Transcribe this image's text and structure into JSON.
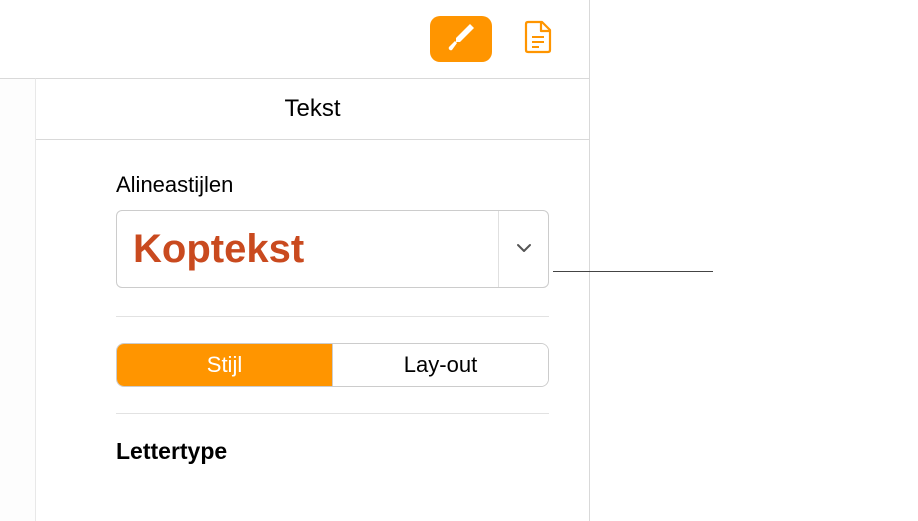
{
  "header": {
    "tab_text": "Tekst"
  },
  "paragraph_styles": {
    "label": "Alineastijlen",
    "selected": "Koptekst"
  },
  "segmented": {
    "style": "Stijl",
    "layout": "Lay-out"
  },
  "font_section": {
    "heading": "Lettertype"
  }
}
